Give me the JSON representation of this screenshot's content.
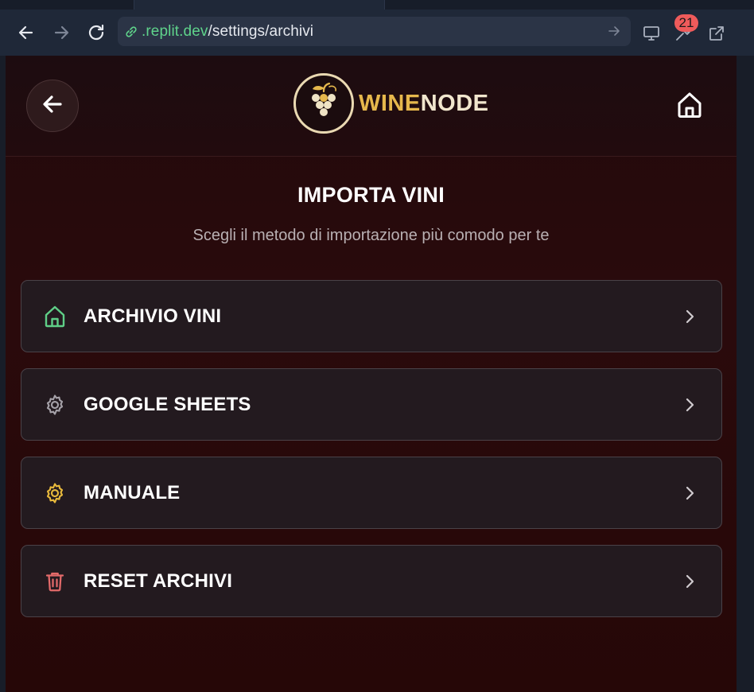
{
  "browser": {
    "url_host": ".replit.dev",
    "url_path": "/settings/archivi",
    "badge_count": "21",
    "icons": [
      "back-arrow-icon",
      "forward-arrow-icon",
      "reload-icon",
      "link-icon",
      "go-arrow-icon",
      "monitor-icon",
      "tools-icon",
      "external-link-icon"
    ]
  },
  "header": {
    "logo_text_a": "WINE",
    "logo_text_b": "NODE"
  },
  "page": {
    "title": "IMPORTA VINI",
    "subtitle": "Scegli il metodo di importazione più comodo per te"
  },
  "menu": [
    {
      "label": "ARCHIVIO VINI",
      "icon": "home-icon",
      "color": "#5fcf87"
    },
    {
      "label": "GOOGLE SHEETS",
      "icon": "gear-icon",
      "color": "#a5a1a8"
    },
    {
      "label": "MANUALE",
      "icon": "gear-icon",
      "color": "#e8b93c"
    },
    {
      "label": "RESET ARCHIVI",
      "icon": "trash-icon",
      "color": "#e36a6a"
    }
  ],
  "colors": {
    "accent_gold": "#e6b84c",
    "url_host": "#5fd38b",
    "badge": "#ef5b5b"
  }
}
